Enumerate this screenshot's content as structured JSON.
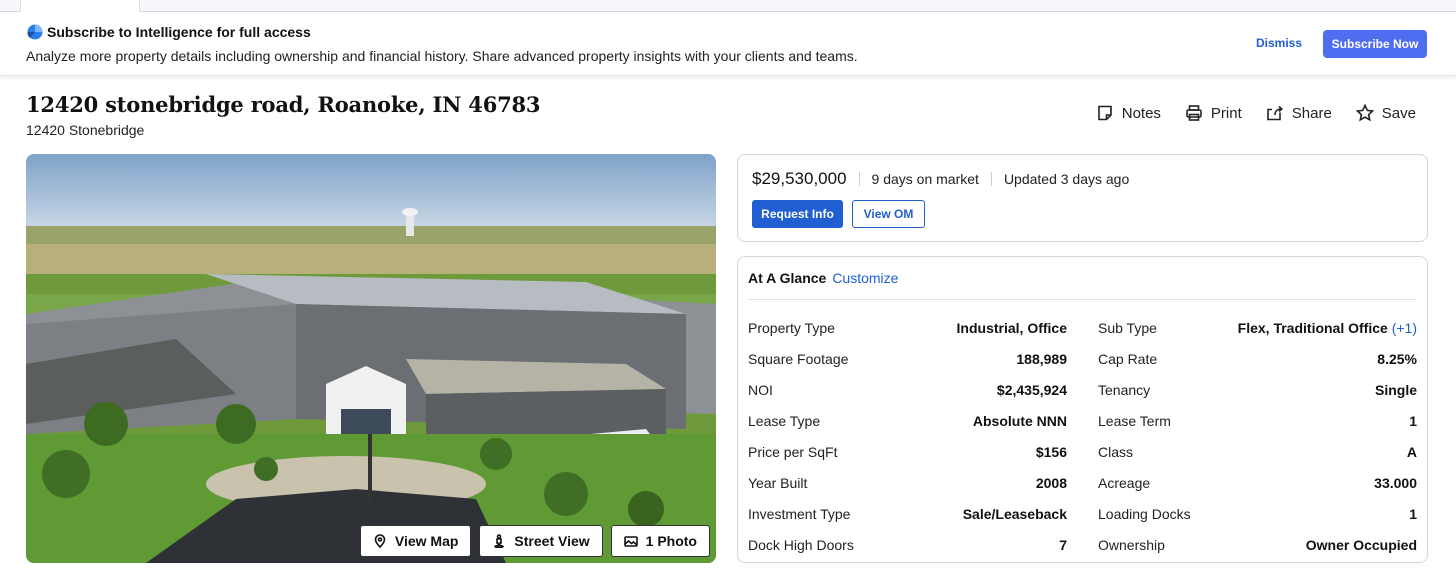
{
  "banner": {
    "title": "Subscribe to Intelligence for full access",
    "description": "Analyze more property details including ownership and financial history. Share advanced property insights with your clients and teams.",
    "dismiss_label": "Dismiss",
    "subscribe_label": "Subscribe Now"
  },
  "property": {
    "address": "12420 stonebridge road, Roanoke, IN 46783",
    "subtitle": "12420 Stonebridge"
  },
  "actions": [
    {
      "label": "Notes",
      "icon": "notes-icon"
    },
    {
      "label": "Print",
      "icon": "print-icon"
    },
    {
      "label": "Share",
      "icon": "share-icon"
    },
    {
      "label": "Save",
      "icon": "star-icon"
    }
  ],
  "photo": {
    "buttons": [
      {
        "label": "View Map",
        "icon": "map-pin-icon"
      },
      {
        "label": "Street View",
        "icon": "street-view-icon"
      },
      {
        "label": "1 Photo",
        "icon": "photo-icon"
      }
    ]
  },
  "listing": {
    "price": "$29,530,000",
    "days_on_market": "9 days on market",
    "updated": "Updated 3 days ago",
    "request_info_label": "Request Info",
    "view_om_label": "View OM"
  },
  "glance": {
    "title": "At A Glance",
    "customize_label": "Customize",
    "left": [
      {
        "key": "Property Type",
        "value": "Industrial, Office"
      },
      {
        "key": "Square Footage",
        "value": "188,989"
      },
      {
        "key": "NOI",
        "value": "$2,435,924"
      },
      {
        "key": "Lease Type",
        "value": "Absolute NNN"
      },
      {
        "key": "Price per SqFt",
        "value": "$156"
      },
      {
        "key": "Year Built",
        "value": "2008"
      },
      {
        "key": "Investment Type",
        "value": "Sale/Leaseback"
      },
      {
        "key": "Dock High Doors",
        "value": "7"
      }
    ],
    "right": [
      {
        "key": "Sub Type",
        "value": "Flex, Traditional Office",
        "extra": "(+1)"
      },
      {
        "key": "Cap Rate",
        "value": "8.25%"
      },
      {
        "key": "Tenancy",
        "value": "Single"
      },
      {
        "key": "Lease Term",
        "value": "1"
      },
      {
        "key": "Class",
        "value": "A"
      },
      {
        "key": "Acreage",
        "value": "33.000"
      },
      {
        "key": "Loading Docks",
        "value": "1"
      },
      {
        "key": "Ownership",
        "value": "Owner Occupied"
      }
    ]
  },
  "colors": {
    "accent": "#1f5fd1",
    "subscribe": "#4f6df0"
  }
}
